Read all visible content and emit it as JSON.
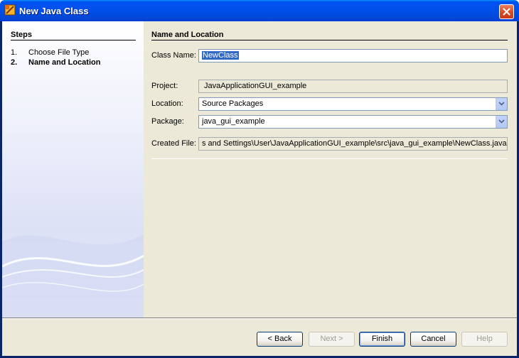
{
  "window": {
    "title": "New Java Class",
    "title_icon": "netbeans-icon",
    "close_icon": "close-icon"
  },
  "steps": {
    "title": "Steps",
    "items": [
      {
        "number": "1.",
        "label": "Choose File Type",
        "current": false
      },
      {
        "number": "2.",
        "label": "Name and Location",
        "current": true
      }
    ]
  },
  "panel": {
    "title": "Name and Location",
    "class_name_label": "Class Name:",
    "class_name_value": "NewClass",
    "project_label": "Project:",
    "project_value": "JavaApplicationGUI_example",
    "location_label": "Location:",
    "location_value": "Source Packages",
    "package_label": "Package:",
    "package_value": "java_gui_example",
    "created_file_label": "Created File:",
    "created_file_value": "s and Settings\\User\\JavaApplicationGUI_example\\src\\java_gui_example\\NewClass.java"
  },
  "buttons": {
    "back": "< Back",
    "next": "Next >",
    "finish": "Finish",
    "cancel": "Cancel",
    "help": "Help"
  },
  "colors": {
    "titlebar": "#0053ee",
    "dialog_background": "#ece9d8",
    "selection": "#316ac5"
  }
}
